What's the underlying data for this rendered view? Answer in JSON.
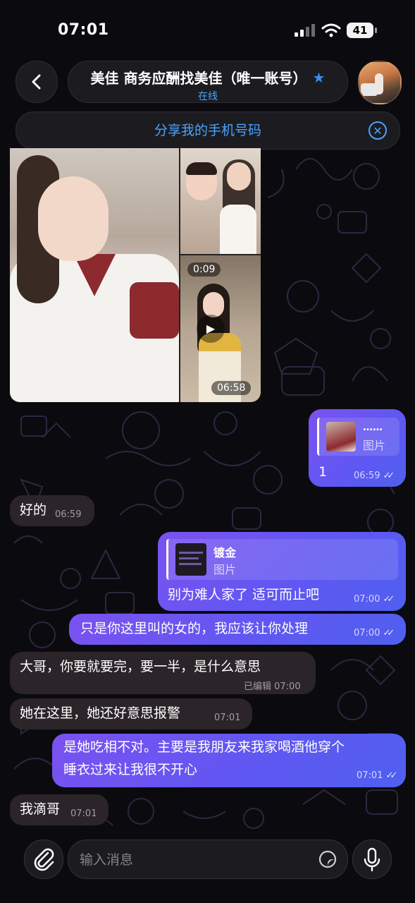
{
  "status_bar": {
    "time": "07:01",
    "battery": "41"
  },
  "header": {
    "title": "美佳 商务应酬找美佳（唯一账号）",
    "status": "在线"
  },
  "share_banner": {
    "label": "分享我的手机号码"
  },
  "album": {
    "video_1_duration": "0:09",
    "video_2_duration": "06:58"
  },
  "messages": [
    {
      "id": "m1",
      "direction": "out",
      "reply_title": "……",
      "reply_sub": "图片",
      "text": "1",
      "time": "06:59"
    },
    {
      "id": "m2",
      "direction": "in",
      "text": "好的",
      "time": "06:59"
    },
    {
      "id": "m3",
      "direction": "out",
      "reply_title": "镀金",
      "reply_sub": "图片",
      "text": "别为难人家了  适可而止吧",
      "time": "07:00"
    },
    {
      "id": "m4",
      "direction": "out",
      "text": "只是你这里叫的女的，我应该让你处理",
      "time": "07:00"
    },
    {
      "id": "m5",
      "direction": "in",
      "text": "大哥，你要就要完，要一半，是什么意思",
      "time": "已编辑 07:00"
    },
    {
      "id": "m6",
      "direction": "in",
      "text": "她在这里，她还好意思报警",
      "time": "07:01"
    },
    {
      "id": "m7",
      "direction": "out",
      "text_line1": "是她吃相不对。主要是我朋友来我家喝酒他穿个",
      "text_line2": "睡衣过来让我很不开心",
      "time": "07:01"
    },
    {
      "id": "m8",
      "direction": "in",
      "text": "我滴哥",
      "time": "07:01"
    }
  ],
  "composer": {
    "placeholder": "输入消息"
  },
  "colors": {
    "accent": "#4aa3ff",
    "outgoing_bubble": "#6a55f2",
    "incoming_bubble": "#2e262c",
    "background": "#0b0b0f"
  },
  "icons": [
    "back-icon",
    "verified-star-icon",
    "close-circle-icon",
    "play-icon",
    "double-check-icon",
    "paperclip-icon",
    "sticker-icon",
    "microphone-icon"
  ]
}
